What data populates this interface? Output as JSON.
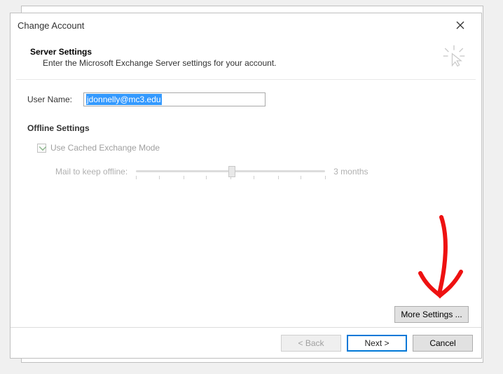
{
  "title": "Change Account",
  "header": {
    "title": "Server Settings",
    "subtitle": "Enter the Microsoft Exchange Server settings for your account."
  },
  "user": {
    "label": "User Name:",
    "value": "jdonnelly@mc3.edu"
  },
  "offline": {
    "title": "Offline Settings",
    "cached_label": "Use Cached Exchange Mode",
    "cached_checked": true,
    "slider_label": "Mail to keep offline:",
    "slider_value": "3 months"
  },
  "buttons": {
    "more_settings": "More Settings ...",
    "back": "< Back",
    "next": "Next >",
    "cancel": "Cancel"
  }
}
